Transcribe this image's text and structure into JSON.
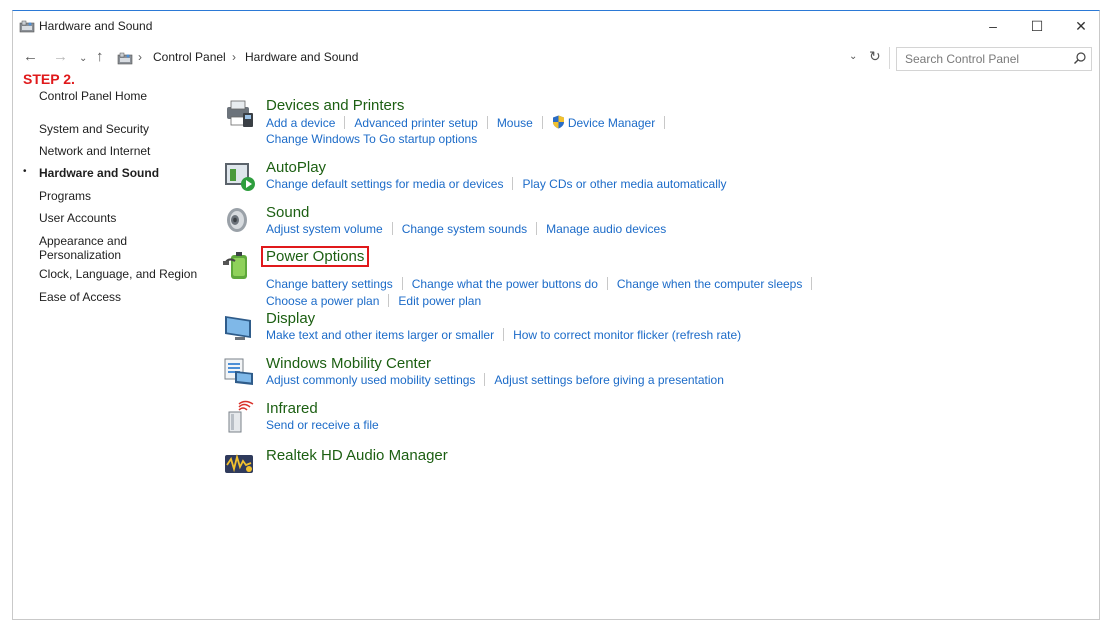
{
  "window": {
    "title": "Hardware and Sound",
    "controls": {
      "minimize": "–",
      "maximize": "☐",
      "close": "✕"
    }
  },
  "nav": {
    "back": "←",
    "forward": "→",
    "recent": "⌄",
    "up": "↑",
    "breadcrumb": [
      "Control Panel",
      "Hardware and Sound"
    ],
    "separator": "›",
    "dropdown": "⌄",
    "refresh": "↻"
  },
  "search": {
    "placeholder": "Search Control Panel"
  },
  "step_label": "STEP 2.",
  "sidebar": {
    "items": [
      {
        "label": "Control Panel Home"
      },
      {
        "label": "System and Security"
      },
      {
        "label": "Network and Internet"
      },
      {
        "label": "Hardware and Sound",
        "active": true
      },
      {
        "label": "Programs"
      },
      {
        "label": "User Accounts"
      },
      {
        "label": "Appearance and\nPersonalization"
      },
      {
        "label": "Clock, Language, and Region"
      },
      {
        "label": "Ease of Access"
      }
    ],
    "bullet": "•"
  },
  "categories": {
    "devices": {
      "title": "Devices and Printers",
      "row1": [
        "Add a device",
        "Advanced printer setup",
        "Mouse",
        "Device Manager"
      ],
      "row2": [
        "Change Windows To Go startup options"
      ]
    },
    "autoplay": {
      "title": "AutoPlay",
      "row1": [
        "Change default settings for media or devices",
        "Play CDs or other media automatically"
      ]
    },
    "sound": {
      "title": "Sound",
      "row1": [
        "Adjust system volume",
        "Change system sounds",
        "Manage audio devices"
      ]
    },
    "power": {
      "title": "Power Options",
      "row1": [
        "Change battery settings",
        "Change what the power buttons do",
        "Change when the computer sleeps"
      ],
      "row2": [
        "Choose a power plan",
        "Edit power plan"
      ]
    },
    "display": {
      "title": "Display",
      "row1": [
        "Make text and other items larger or smaller",
        "How to correct monitor flicker (refresh rate)"
      ]
    },
    "mobility": {
      "title": "Windows Mobility Center",
      "row1": [
        "Adjust commonly used mobility settings",
        "Adjust settings before giving a presentation"
      ]
    },
    "infrared": {
      "title": "Infrared",
      "row1": [
        "Send or receive a file"
      ]
    },
    "realtek": {
      "title": "Realtek HD Audio Manager"
    }
  },
  "colors": {
    "category_title": "#1c5f12",
    "link": "#1c6bc8",
    "highlight": "#e0191b"
  },
  "icons": {
    "title": "control-panel-icon",
    "devices": "devices-printers-icon",
    "autoplay": "autoplay-icon",
    "sound": "speaker-icon",
    "power": "power-options-icon",
    "display": "display-monitor-icon",
    "mobility": "mobility-center-icon",
    "infrared": "infrared-icon",
    "realtek": "realtek-audio-icon",
    "shield": "uac-shield-icon"
  }
}
